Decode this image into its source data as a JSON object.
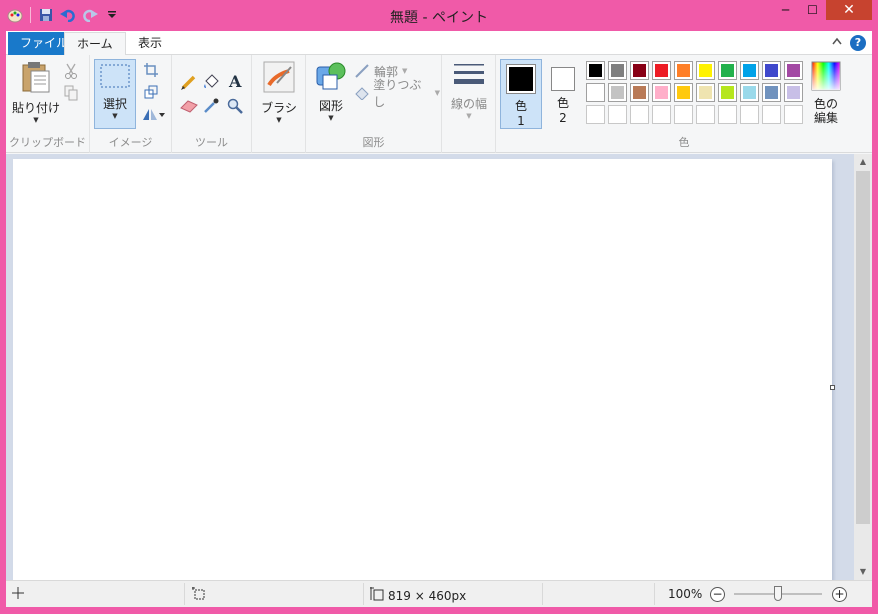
{
  "window": {
    "title": "無題 - ペイント",
    "close": "✕",
    "minimize": "─",
    "maximize": "☐"
  },
  "tabs": {
    "file": "ファイル",
    "home": "ホーム",
    "view": "表示"
  },
  "help": "?",
  "groups": {
    "clipboard": {
      "label": "クリップボード",
      "paste": "貼り付け"
    },
    "image": {
      "label": "イメージ",
      "select": "選択"
    },
    "tools": {
      "label": "ツール"
    },
    "brushes": {
      "label": "ブラシ"
    },
    "shapes": {
      "label": "図形",
      "shapes": "図形",
      "outline": "輪郭",
      "fill": "塗りつぶし"
    },
    "size": {
      "label": "線の幅"
    },
    "colors": {
      "label": "色",
      "color1": "色",
      "color1_num": "1",
      "color2": "色",
      "color2_num": "2",
      "edit": "色の",
      "edit2": "編集",
      "color1_value": "#000000",
      "color2_value": "#ffffff",
      "palette_row1": [
        "#000000",
        "#7f7f7f",
        "#880015",
        "#ed1c24",
        "#ff7f27",
        "#fff200",
        "#22b14c",
        "#00a2e8",
        "#3f48cc",
        "#a349a4"
      ],
      "palette_row2": [
        "#ffffff",
        "#c3c3c3",
        "#b97a57",
        "#ffaec9",
        "#ffc90e",
        "#efe4b0",
        "#b5e61d",
        "#99d9ea",
        "#7092be",
        "#c8bfe7"
      ],
      "palette_row3": [
        "",
        "",
        "",
        "",
        "",
        "",
        "",
        "",
        "",
        ""
      ]
    }
  },
  "status": {
    "dimensions": "819 × 460px",
    "zoom": "100%"
  },
  "accent": "#f05aa8"
}
